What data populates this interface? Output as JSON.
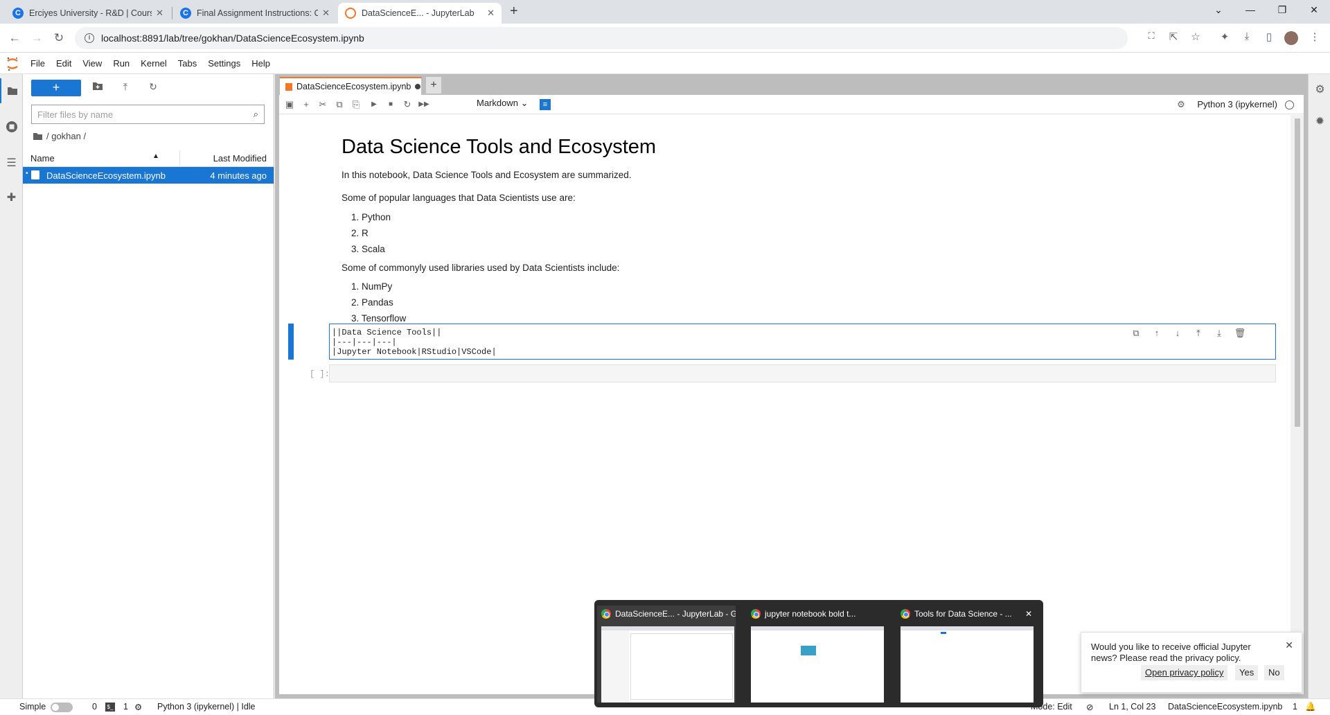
{
  "browser": {
    "tabs": [
      {
        "title": "Erciyes University - R&D | Course",
        "favicon": "coursera-icon"
      },
      {
        "title": "Final Assignment Instructions: Cr",
        "favicon": "coursera-icon"
      },
      {
        "title": "DataScienceE... - JupyterLab",
        "favicon": "jupyter-icon",
        "active": true
      }
    ],
    "new_tab": "+",
    "url": "localhost:8891/lab/tree/gokhan/DataScienceEcosystem.ipynb"
  },
  "menubar": {
    "items": [
      "File",
      "Edit",
      "View",
      "Run",
      "Kernel",
      "Tabs",
      "Settings",
      "Help"
    ]
  },
  "filebrowser": {
    "new_button": "+",
    "filter_placeholder": "Filter files by name",
    "breadcrumb": "/ gokhan /",
    "col_name": "Name",
    "col_modified": "Last Modified",
    "files": [
      {
        "name": "DataScienceEcosystem.ipynb",
        "modified": "4 minutes ago"
      }
    ]
  },
  "notebook": {
    "tab_title": "DataScienceEcosystem.ipynb",
    "cell_type": "Markdown",
    "kernel": "Python 3 (ipykernel)",
    "heading": "Data Science Tools and Ecosystem",
    "intro": "In this notebook, Data Science Tools and Ecosystem are summarized.",
    "languages_intro": "Some of popular languages that Data Scientists use are:",
    "languages": [
      "1. Python",
      "2. R",
      "3. Scala"
    ],
    "libraries_intro": "Some of commonyly used libraries used by Data Scientists include:",
    "libraries": [
      "1. NumPy",
      "2. Pandas",
      "3. Tensorflow"
    ],
    "active_cell_lines": [
      "||Data Science Tools||",
      "|---|---|---|",
      "|Jupyter Notebook|RStudio|VSCode|"
    ],
    "empty_prompt": "[ ]:"
  },
  "statusbar": {
    "mode_label": "Simple",
    "terminals": "0",
    "kernels": "1",
    "kernel_status": "Python 3 (ipykernel) | Idle",
    "mode": "Mode: Edit",
    "cursor": "Ln 1, Col 23",
    "filename": "DataScienceEcosystem.ipynb",
    "notifications": "1"
  },
  "taskbar_previews": [
    {
      "title": "DataScienceE... - JupyterLab - G..."
    },
    {
      "title": "jupyter notebook bold t..."
    },
    {
      "title": "Tools for Data Science - ..."
    }
  ],
  "notification": {
    "message": "Would you like to receive official Jupyter news? Please read the privacy policy.",
    "link": "Open privacy policy",
    "yes": "Yes",
    "no": "No"
  },
  "colors": {
    "accent": "#1976d2",
    "jupyter_orange": "#f37726"
  }
}
